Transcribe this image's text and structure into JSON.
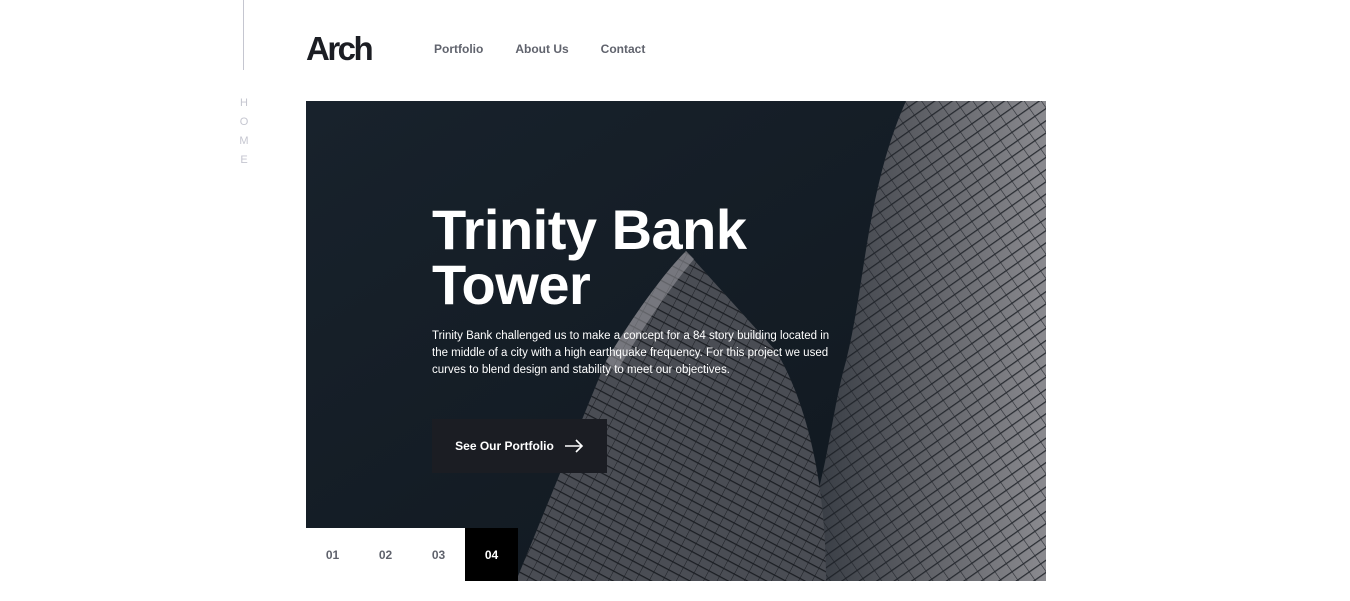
{
  "sidebar": {
    "label_letters": [
      "H",
      "O",
      "M",
      "E"
    ]
  },
  "header": {
    "logo": "Arch",
    "nav": [
      {
        "label": "Portfolio"
      },
      {
        "label": "About Us"
      },
      {
        "label": "Contact"
      }
    ]
  },
  "hero": {
    "title": "Trinity Bank Tower",
    "description": "Trinity Bank challenged us to make a concept for a 84 story building located in the middle of a city with a high earthquake frequency. For this project we used curves to blend design and stability to meet our objectives.",
    "cta_label": "See Our Portfolio",
    "cta_icon": "arrow-right-icon"
  },
  "pager": {
    "pages": [
      "01",
      "02",
      "03",
      "04"
    ],
    "active": "04"
  },
  "colors": {
    "dark": "#1b1d23",
    "hero_bg": "#141d26",
    "nav_text": "#60636d",
    "side_text": "#c5c6d0"
  }
}
